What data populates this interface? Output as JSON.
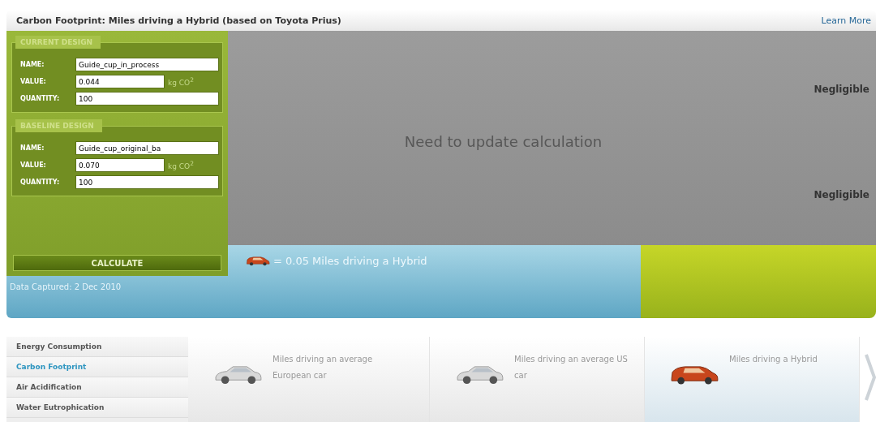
{
  "header": {
    "title": "Carbon Footprint: Miles driving a Hybrid (based on Toyota Prius)",
    "link": "Learn More"
  },
  "designs": [
    {
      "legend": "CURRENT DESIGN",
      "fields": [
        {
          "label": "NAME:",
          "value": "Guide_cup_in_process"
        },
        {
          "label": "VALUE:",
          "value": "0.044",
          "unit": "kg CO$^{2}$"
        },
        {
          "label": "QUANTITY:",
          "value": "100"
        }
      ]
    },
    {
      "legend": "BASELINE DESIGN",
      "fields": [
        {
          "label": "NAME:",
          "value": "Guide_cup_original_ba"
        },
        {
          "label": "VALUE:",
          "value": "0.070",
          "unit": "kg CO$^{2}$"
        },
        {
          "label": "QUANTITY:",
          "value": "100"
        }
      ]
    }
  ],
  "calculate_button": "CALCULATE",
  "results": {
    "message": "Need to update calculation",
    "current": "Negligible",
    "baseline": "Negligible"
  },
  "equivalence": "= 0.05 Miles driving a Hybrid",
  "data_captured": "Data Captured: 2 Dec 2010",
  "menu": [
    {
      "label": "Energy Consumption",
      "selected": false
    },
    {
      "label": "Carbon Footprint",
      "selected": true
    },
    {
      "label": "Air Acidification",
      "selected": false
    },
    {
      "label": "Water Eutrophication",
      "selected": false
    }
  ],
  "cards": [
    {
      "kind": "sedan",
      "text": "Miles driving an average European car",
      "selected": false
    },
    {
      "kind": "sedan",
      "text": "Miles driving an average US car",
      "selected": false
    },
    {
      "kind": "hybrid",
      "text": "Miles driving a Hybrid",
      "selected": true
    }
  ]
}
